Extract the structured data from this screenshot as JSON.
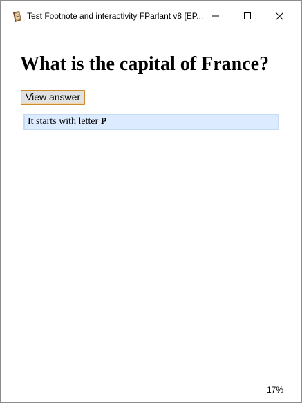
{
  "window": {
    "title": "Test Footnote and interactivity FParlant v8 [EP..."
  },
  "content": {
    "question": "What is the capital of France?",
    "view_answer_label": "View answer",
    "hint_text": "It starts with letter ",
    "hint_letter": "P"
  },
  "status": {
    "progress": "17%"
  },
  "icons": {
    "app": "ebook-app-icon",
    "minimize": "minimize-icon",
    "maximize": "maximize-icon",
    "close": "close-icon"
  }
}
